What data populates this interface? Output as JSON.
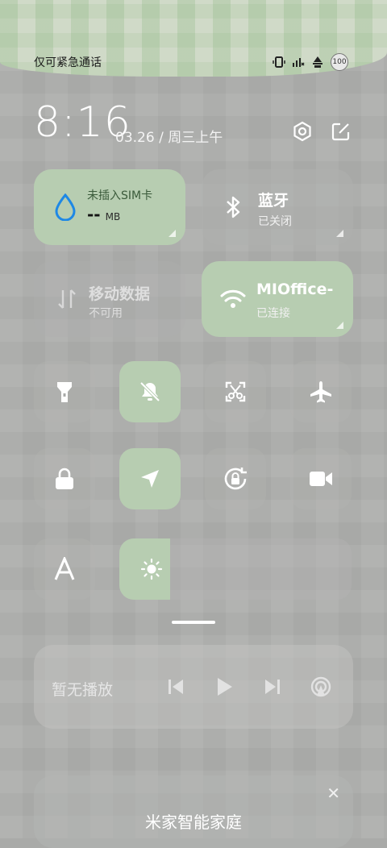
{
  "status_bar": {
    "carrier_text": "仅可紧急通话",
    "battery": "100"
  },
  "header": {
    "time": "8:16",
    "date": "03.26 / 周三上午"
  },
  "tiles": {
    "sim": {
      "title": "未插入SIM卡",
      "value": "--",
      "unit": "MB"
    },
    "bluetooth": {
      "title": "蓝牙",
      "status": "已关闭"
    },
    "mobile_data": {
      "title": "移动数据",
      "status": "不可用"
    },
    "wifi": {
      "title": "MIOffice-",
      "status": "已连接"
    }
  },
  "toggles": [
    {
      "name": "flashlight",
      "active": false
    },
    {
      "name": "mute",
      "active": true
    },
    {
      "name": "screenshot",
      "active": false
    },
    {
      "name": "airplane-mode",
      "active": false
    },
    {
      "name": "lock-screen",
      "active": false
    },
    {
      "name": "location",
      "active": true
    },
    {
      "name": "auto-rotate",
      "active": false
    },
    {
      "name": "screen-recorder",
      "active": false
    },
    {
      "name": "font-size",
      "active": false
    }
  ],
  "brightness": {
    "level": 0.22
  },
  "media": {
    "text": "暂无播放"
  },
  "smart_home": {
    "title": "米家智能家庭",
    "close": "✕"
  },
  "colors": {
    "accent_green": "#b7cdb1",
    "water_blue": "#1e88e5"
  }
}
